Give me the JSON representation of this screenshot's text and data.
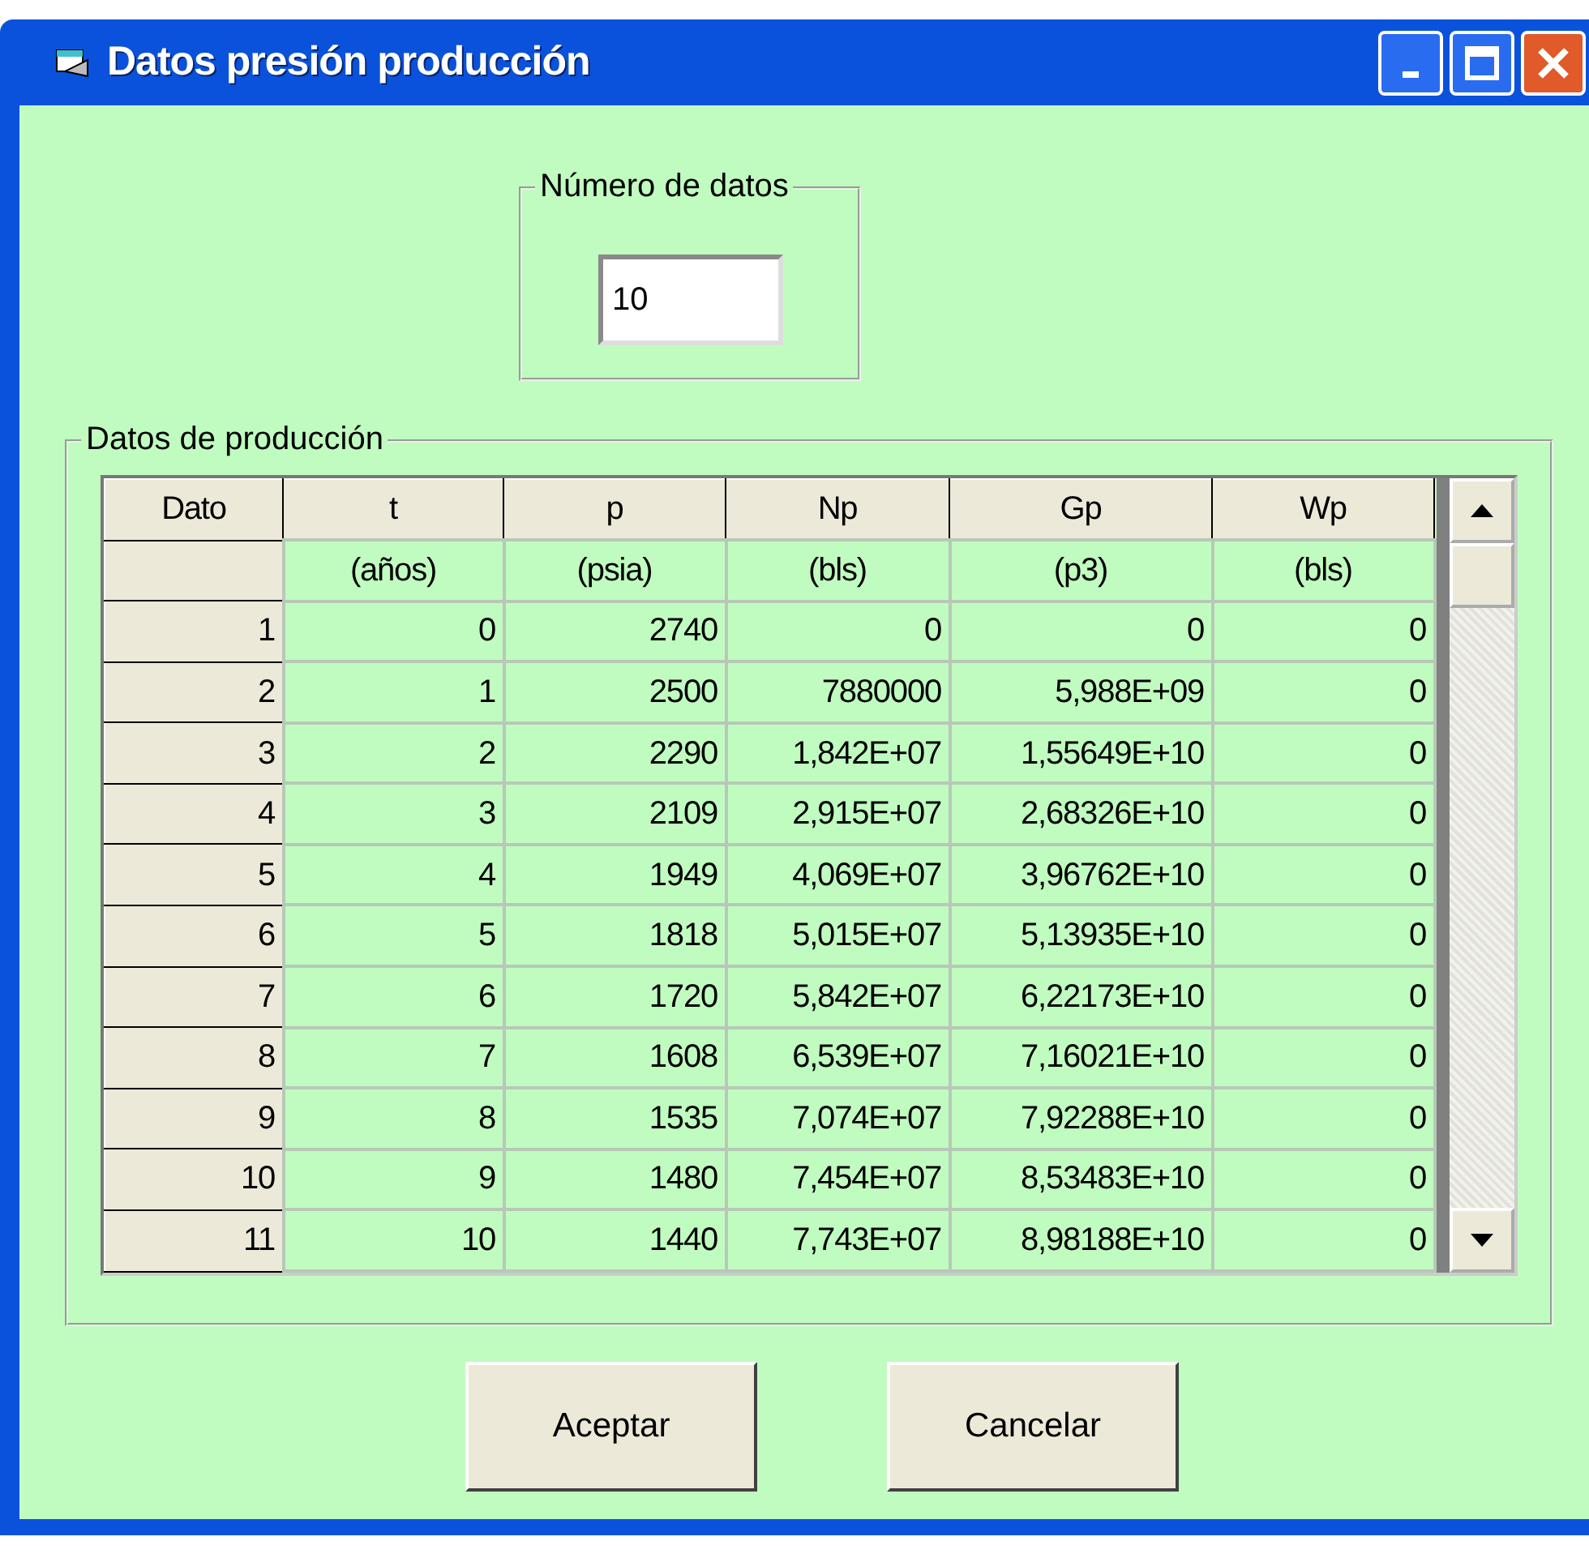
{
  "window": {
    "title": "Datos presión producción"
  },
  "count_frame": {
    "label": "Número de datos",
    "value": "10"
  },
  "data_frame": {
    "label": "Datos de producción"
  },
  "table": {
    "columns": [
      {
        "name": "Dato"
      },
      {
        "name": "t",
        "unit": "(años)"
      },
      {
        "name": "p",
        "unit": "(psia)"
      },
      {
        "name": "Np",
        "unit": "(bls)"
      },
      {
        "name": "Gp",
        "unit": "(p3)"
      },
      {
        "name": "Wp",
        "unit": "(bls)"
      }
    ],
    "rows": [
      [
        "1",
        "0",
        "2740",
        "0",
        "0",
        "0"
      ],
      [
        "2",
        "1",
        "2500",
        "7880000",
        "5,988E+09",
        "0"
      ],
      [
        "3",
        "2",
        "2290",
        "1,842E+07",
        "1,55649E+10",
        "0"
      ],
      [
        "4",
        "3",
        "2109",
        "2,915E+07",
        "2,68326E+10",
        "0"
      ],
      [
        "5",
        "4",
        "1949",
        "4,069E+07",
        "3,96762E+10",
        "0"
      ],
      [
        "6",
        "5",
        "1818",
        "5,015E+07",
        "5,13935E+10",
        "0"
      ],
      [
        "7",
        "6",
        "1720",
        "5,842E+07",
        "6,22173E+10",
        "0"
      ],
      [
        "8",
        "7",
        "1608",
        "6,539E+07",
        "7,16021E+10",
        "0"
      ],
      [
        "9",
        "8",
        "1535",
        "7,074E+07",
        "7,92288E+10",
        "0"
      ],
      [
        "10",
        "9",
        "1480",
        "7,454E+07",
        "8,53483E+10",
        "0"
      ],
      [
        "11",
        "10",
        "1440",
        "7,743E+07",
        "8,98188E+10",
        "0"
      ]
    ]
  },
  "buttons": [
    "Aceptar",
    "Cancelar"
  ]
}
